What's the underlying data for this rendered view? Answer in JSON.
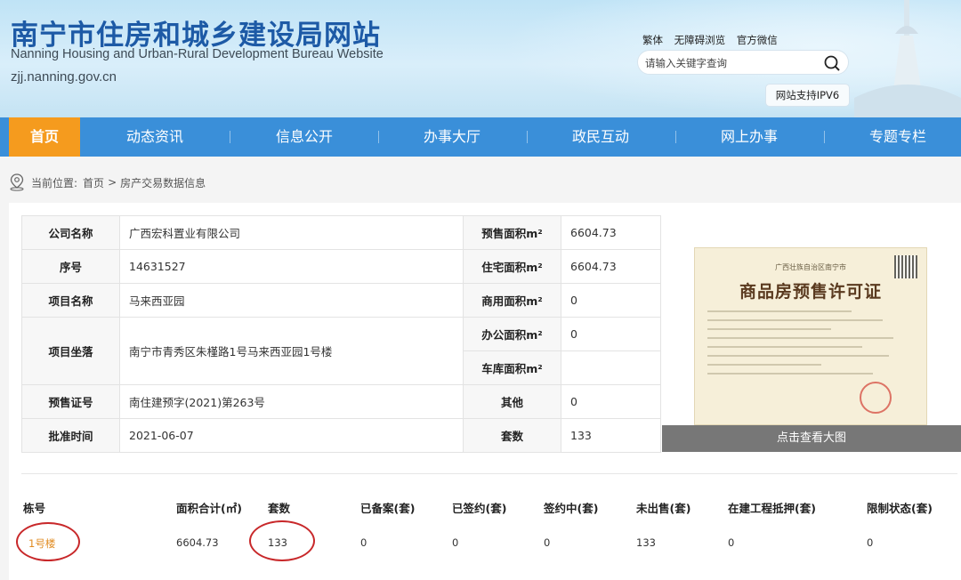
{
  "header": {
    "title": "南宁市住房和城乡建设局网站",
    "title_en": "Nanning Housing and Urban-Rural Development Bureau Website",
    "domain": "zjj.nanning.gov.cn",
    "top_links": [
      "繁体",
      "无障碍浏览",
      "官方微信"
    ],
    "search_placeholder": "请输入关键字查询",
    "ipv6_badge": "网站支持IPV6"
  },
  "nav": {
    "items": [
      "首页",
      "动态资讯",
      "信息公开",
      "办事大厅",
      "政民互动",
      "网上办事",
      "专题专栏"
    ],
    "active": "首页"
  },
  "breadcrumb": {
    "prefix": "当前位置:",
    "items": [
      "首页",
      "房产交易数据信息"
    ],
    "separator": ">"
  },
  "info": {
    "company_label": "公司名称",
    "company": "广西宏科置业有限公司",
    "serial_label": "序号",
    "serial": "14631527",
    "project_label": "项目名称",
    "project": "马来西亚园",
    "location_label": "项目坐落",
    "location": "南宁市青秀区朱槿路1号马来西亚园1号楼",
    "presale_no_label": "预售证号",
    "presale_no": "南住建预字(2021)第263号",
    "approval_label": "批准时间",
    "approval": "2021-06-07",
    "presale_area_label": "预售面积m²",
    "presale_area": "6604.73",
    "residential_area_label": "住宅面积m²",
    "residential_area": "6604.73",
    "commercial_area_label": "商用面积m²",
    "commercial_area": "0",
    "office_area_label": "办公面积m²",
    "office_area": "0",
    "garage_area_label": "车库面积m²",
    "garage_area": "",
    "other_label": "其他",
    "other": "0",
    "units_label": "套数",
    "units": "133"
  },
  "license": {
    "issuer": "广西壮族自治区南宁市",
    "title": "商品房预售许可证",
    "view_label": "点击查看大图"
  },
  "buildings": {
    "headers": [
      "栋号",
      "面积合计(㎡)",
      "套数",
      "已备案(套)",
      "已签约(套)",
      "签约中(套)",
      "未出售(套)",
      "在建工程抵押(套)",
      "限制状态(套)"
    ],
    "rows": [
      [
        "1号楼",
        "6604.73",
        "133",
        "0",
        "0",
        "0",
        "133",
        "0",
        "0"
      ]
    ]
  },
  "colors": {
    "nav_bg": "#3a8fd9",
    "nav_active": "#f59b1e",
    "title_blue": "#1d5aa6",
    "link_orange": "#e08a1f",
    "annotation_red": "#c8282a"
  }
}
